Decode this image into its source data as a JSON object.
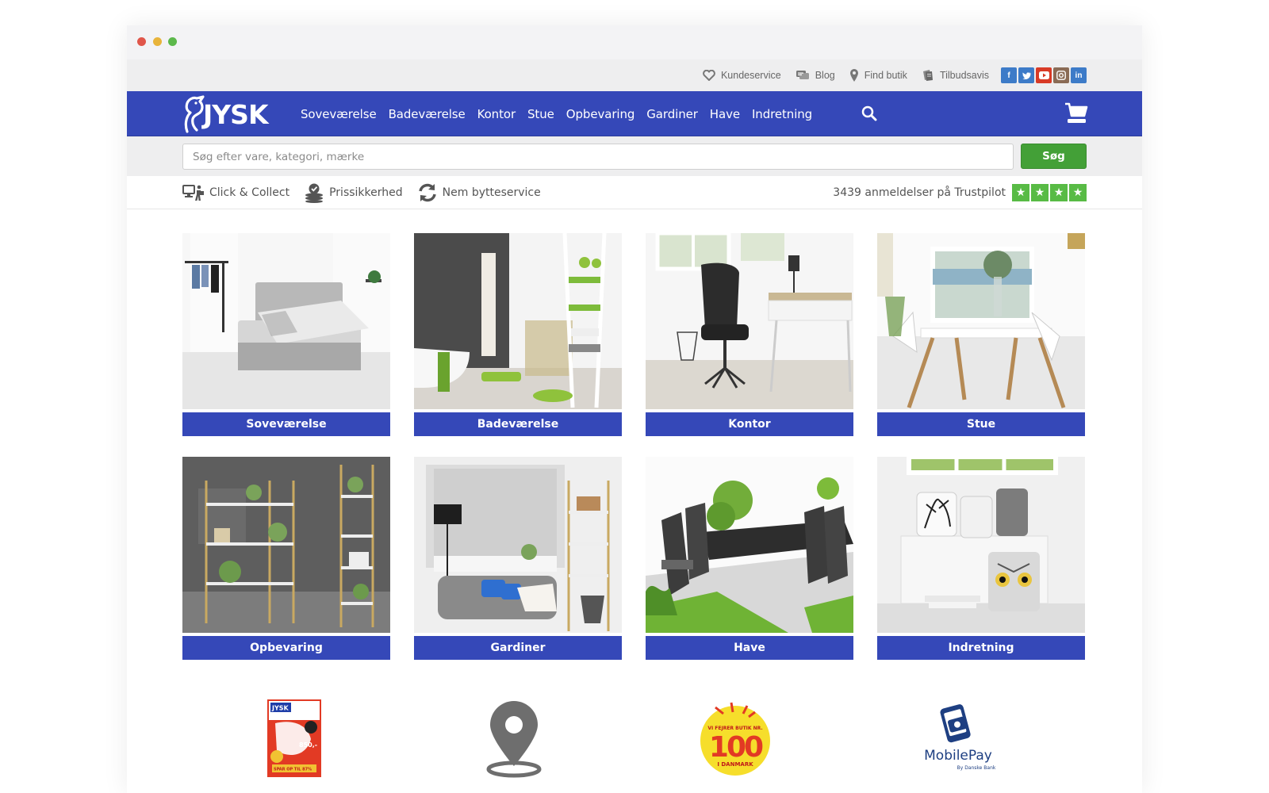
{
  "utility_links": [
    {
      "label": "Kundeservice",
      "icon": "heart-icon"
    },
    {
      "label": "Blog",
      "icon": "chat-bubbles-icon"
    },
    {
      "label": "Find butik",
      "icon": "map-pin-icon"
    },
    {
      "label": "Tilbudsavis",
      "icon": "leaflet-icon"
    }
  ],
  "social": [
    "f",
    "t",
    "yt",
    "ig",
    "in"
  ],
  "nav": {
    "logo": "JYSK",
    "items": [
      "Soveværelse",
      "Badeværelse",
      "Kontor",
      "Stue",
      "Opbevaring",
      "Gardiner",
      "Have",
      "Indretning"
    ]
  },
  "search": {
    "placeholder": "Søg efter vare, kategori, mærke",
    "button": "Søg"
  },
  "usps": [
    "Click & Collect",
    "Prissikkerhed",
    "Nem bytteservice"
  ],
  "trustpilot": {
    "text": "3439 anmeldelser på Trustpilot",
    "stars": 4
  },
  "categories": [
    "Soveværelse",
    "Badeværelse",
    "Kontor",
    "Stue",
    "Opbevaring",
    "Gardiner",
    "Have",
    "Indretning"
  ],
  "promos": {
    "leaflet": {
      "brand": "JYSK",
      "price": "850,-",
      "offer": "SPAR OP TIL 87%"
    },
    "celebration": {
      "top": "VI FEJRER BUTIK NR.",
      "number": "100",
      "bottom": "I DANMARK"
    },
    "mobilepay": {
      "name": "MobilePay",
      "sub": "By Danske Bank"
    }
  },
  "colors": {
    "brand_blue": "#3548b8",
    "button_green": "#43a037",
    "trustpilot_green": "#58bb45"
  }
}
